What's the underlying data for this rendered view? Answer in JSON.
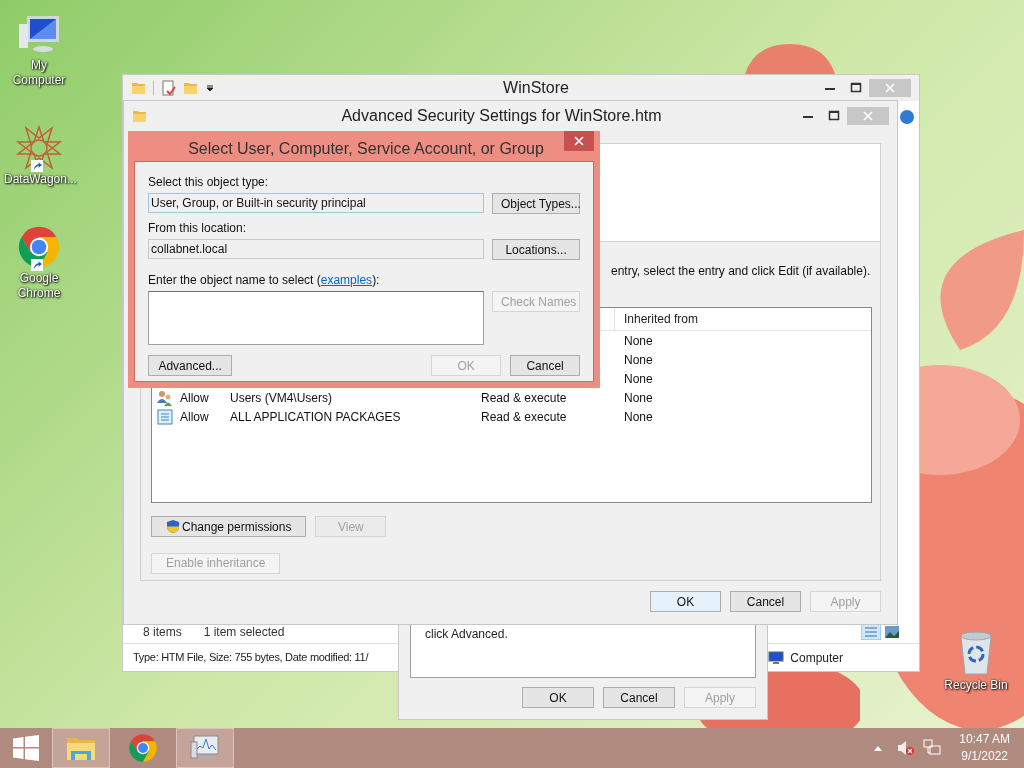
{
  "desktop_icons": [
    {
      "kind": "computer",
      "label": "My Computer",
      "shortcut": false
    },
    {
      "kind": "star",
      "label": "DataWagon...",
      "shortcut": true
    },
    {
      "kind": "chrome",
      "label": "Google Chrome",
      "shortcut": true
    }
  ],
  "recycle_bin": {
    "label": "Recycle Bin"
  },
  "explorer": {
    "title": "WinStore",
    "item_count": "8 items",
    "selection": "1 item selected",
    "details": "Type: HTM File, Size: 755 bytes, Date modified: 11/",
    "location": "Computer"
  },
  "back_dialog": {
    "text": "click Advanced.",
    "buttons": [
      {
        "label": "OK",
        "disabled": false
      },
      {
        "label": "Cancel",
        "disabled": false
      },
      {
        "label": "Apply",
        "disabled": true
      }
    ]
  },
  "security": {
    "title": "Advanced Security Settings for WinStore.htm",
    "instruction": "entry, select the entry and click Edit (if available).",
    "column": "Inherited from",
    "rows": [
      {
        "inherited": "None"
      },
      {
        "inherited": "None"
      },
      {
        "inherited": "None"
      },
      {
        "kind": "users",
        "type": "Allow",
        "principal": "Users (VM4\\Users)",
        "access": "Read & execute",
        "inherited": "None"
      },
      {
        "kind": "package",
        "type": "Allow",
        "principal": "ALL APPLICATION PACKAGES",
        "access": "Read & execute",
        "inherited": "None"
      }
    ],
    "actions": [
      {
        "label": "Change permissions",
        "disabled": false,
        "shield": true
      },
      {
        "label": "View",
        "disabled": true,
        "shield": false
      }
    ],
    "inheritance_button": {
      "label": "Enable inheritance",
      "disabled": true
    },
    "buttons": [
      {
        "label": "OK",
        "disabled": false,
        "default": true
      },
      {
        "label": "Cancel",
        "disabled": false,
        "default": false
      },
      {
        "label": "Apply",
        "disabled": true,
        "default": false
      }
    ]
  },
  "select_dialog": {
    "title": "Select User, Computer, Service Account, or Group",
    "object_type_label": "Select this object type:",
    "object_type": "User, Group, or Built-in security principal",
    "object_types_button": "Object Types...",
    "location_label": "From this location:",
    "location": "collabnet.local",
    "locations_button": "Locations...",
    "name_label": "Enter the object name to select (",
    "examples_link": "examples",
    "name_label_end": "):",
    "check_names": {
      "label": "Check Names",
      "disabled": true
    },
    "buttons": [
      {
        "label": "Advanced...",
        "disabled": false
      },
      {
        "label": "OK",
        "disabled": true
      },
      {
        "label": "Cancel",
        "disabled": false
      }
    ]
  },
  "taskbar": {
    "apps": [
      {
        "kind": "explorer",
        "running": true
      },
      {
        "kind": "chrome",
        "running": false
      },
      {
        "kind": "monitor",
        "running": true
      }
    ],
    "time": "10:47 AM",
    "date": "9/1/2022"
  }
}
